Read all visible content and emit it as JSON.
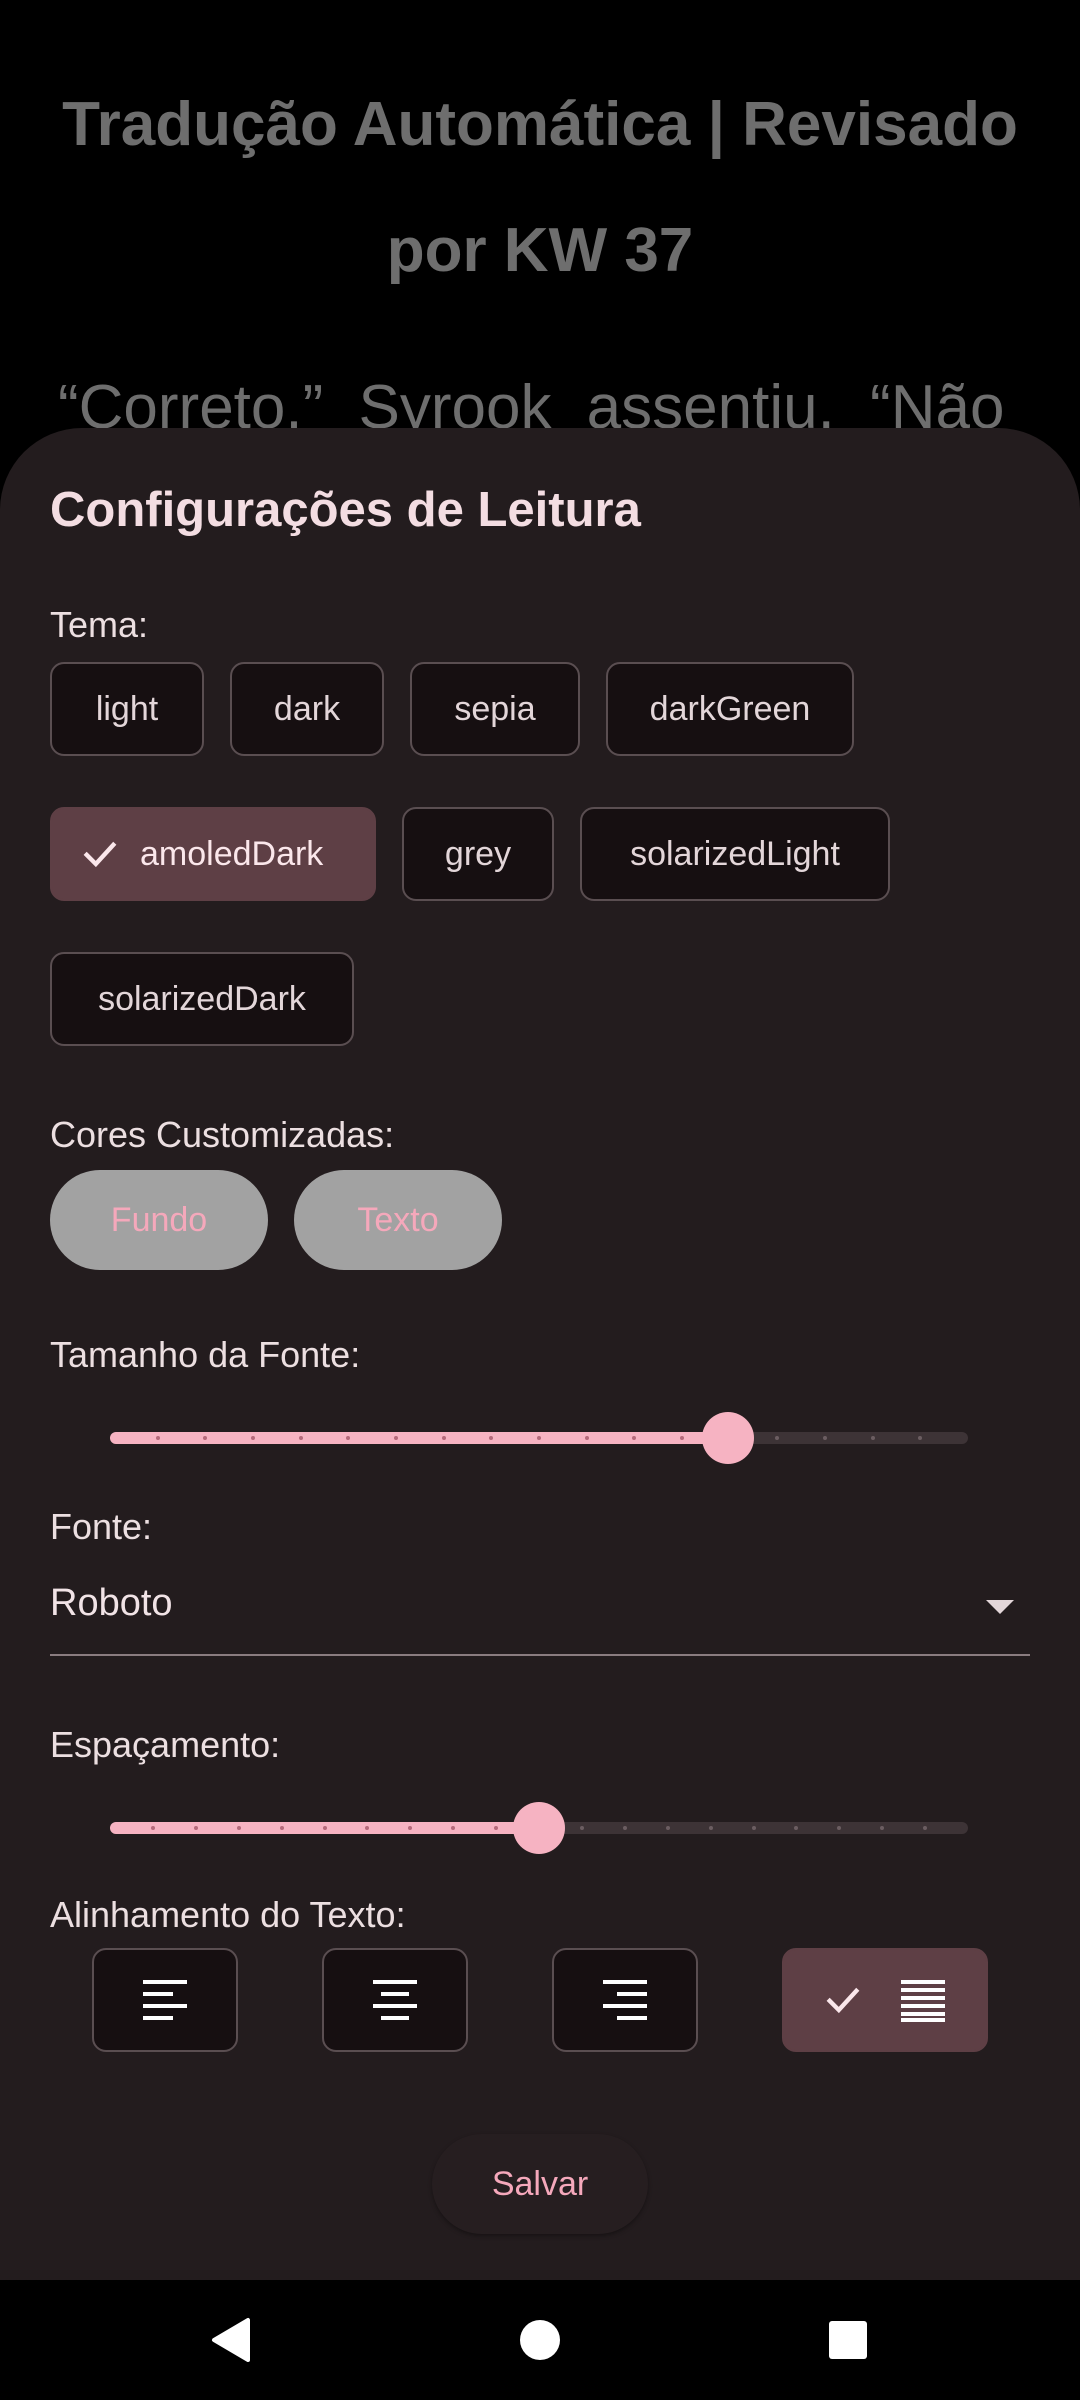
{
  "background": {
    "title_line1": "Tradução Automática | Revisado",
    "title_line2": "por KW 37",
    "body_line": "“Correto.” Syrook assentiu. “Não"
  },
  "sheet": {
    "title": "Configurações de Leitura",
    "theme_label": "Tema:",
    "themes": [
      {
        "label": "light",
        "selected": false
      },
      {
        "label": "dark",
        "selected": false
      },
      {
        "label": "sepia",
        "selected": false
      },
      {
        "label": "darkGreen",
        "selected": false
      },
      {
        "label": "amoledDark",
        "selected": true
      },
      {
        "label": "grey",
        "selected": false
      },
      {
        "label": "solarizedLight",
        "selected": false
      },
      {
        "label": "solarizedDark",
        "selected": false
      }
    ],
    "custom_colors_label": "Cores Customizadas:",
    "background_color_button": "Fundo",
    "text_color_button": "Texto",
    "font_size_label": "Tamanho da Fonte:",
    "font_size_slider": {
      "fraction": 0.72,
      "divisions": 18
    },
    "font_label": "Fonte:",
    "font_value": "Roboto",
    "spacing_label": "Espaçamento:",
    "spacing_slider": {
      "fraction": 0.5,
      "divisions": 20
    },
    "alignment_label": "Alinhamento do Texto:",
    "alignments": [
      {
        "name": "left",
        "selected": false
      },
      {
        "name": "center",
        "selected": false
      },
      {
        "name": "right",
        "selected": false
      },
      {
        "name": "justify",
        "selected": true
      }
    ],
    "save_label": "Salvar"
  },
  "colors": {
    "accent": "#f6b3c2",
    "sheet_background": "#231c1e",
    "selected_chip": "#5e3f45"
  },
  "navbar": {
    "icons": [
      "back-icon",
      "home-icon",
      "recents-icon"
    ]
  }
}
